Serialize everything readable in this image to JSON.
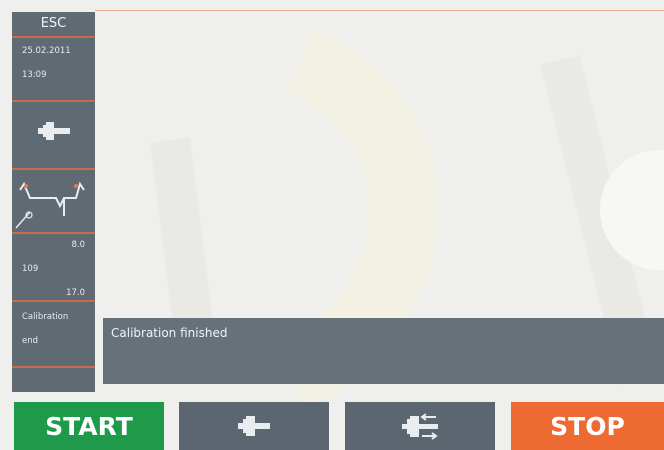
{
  "sidebar": {
    "esc_label": "ESC",
    "date": "25.02.2011",
    "time": "13:09",
    "icons": [
      "calibration-weight-icon",
      "rim-profile-icon"
    ],
    "value_top": "8.0",
    "value_left": "109",
    "value_bottom": "17.0",
    "status_line1": "Calibration",
    "status_line2": "end"
  },
  "message": {
    "text": "Calibration finished"
  },
  "buttons": {
    "start_label": "START",
    "stop_label": "STOP",
    "mode1_icon": "weight-position-icon",
    "mode2_icon": "clamp-adjust-icon"
  },
  "colors": {
    "start": "#1f9a4a",
    "stop": "#ee6a33",
    "panel": "#5f6a73",
    "accent_line": "#c96b4d"
  }
}
